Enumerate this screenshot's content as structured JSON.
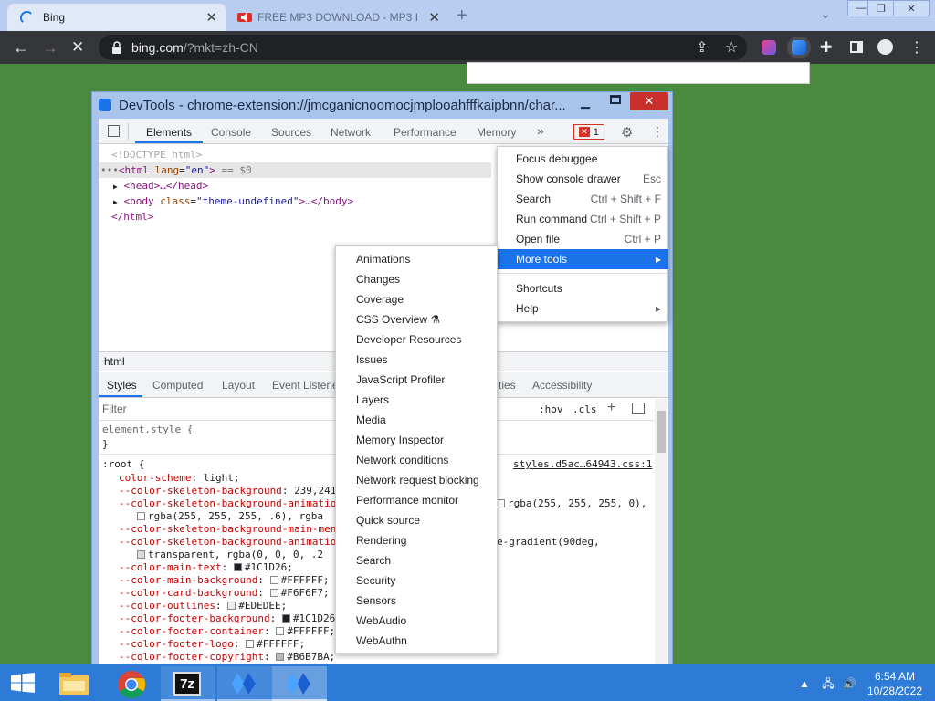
{
  "browser": {
    "tabs": [
      {
        "title": "Bing",
        "active": true
      },
      {
        "title": "FREE MP3 DOWNLOAD - MP3 I",
        "active": false
      }
    ],
    "new_tab_symbol": "+",
    "url_host": "bing.com",
    "url_rest": "/?mkt=zh-CN",
    "window_buttons": [
      "—",
      "❐",
      "✕"
    ]
  },
  "devtools": {
    "title": "DevTools - chrome-extension://jmcganicnoomocjmplooahfffkaipbnn/char...",
    "tabs": [
      "Elements",
      "Console",
      "Sources",
      "Network",
      "Performance",
      "Memory",
      "»"
    ],
    "error_count": "1",
    "dom": {
      "doctype": "<!DOCTYPE html>",
      "html_open": "<html",
      "html_attr": "lang",
      "html_val": "\"en\"",
      "html_close_bracket": ">",
      "selected_marker": "== $0",
      "head": "<head>…</head>",
      "body_open": "<body",
      "body_attr": "class",
      "body_val": "\"theme-undefined\"",
      "body_tail": ">…</body>",
      "html_end": "</html>"
    },
    "breadcrumb": "html",
    "styles_tabs": [
      "Styles",
      "Computed",
      "Layout",
      "Event Listene",
      "ties",
      "Accessibility"
    ],
    "filter_placeholder": "Filter",
    "hov": ":hov",
    "cls": ".cls",
    "styles": {
      "element_style": "element.style {",
      "close_brace": "}",
      "root_selector": ":root {",
      "source_link": "styles.d5ac…64943.css:1",
      "lines": [
        {
          "prop": "color-scheme",
          "val": "light;"
        },
        {
          "prop": "--color-skeleton-background",
          "val": "239,241"
        },
        {
          "prop": "--color-skeleton-background-animatio",
          "val": "rgba(255, 255, 255, 0),"
        },
        {
          "prop": "",
          "val": "rgba(255, 255, 255, .6),   rgba"
        },
        {
          "prop": "--color-skeleton-background-main-men",
          "val": ""
        },
        {
          "prop": "--color-skeleton-background-animatio",
          "val": "e-gradient(90deg,"
        },
        {
          "prop": "",
          "val": "transparent,   rgba(0, 0, 0, .2"
        },
        {
          "prop": "--color-main-text",
          "val": "#1C1D26;"
        },
        {
          "prop": "--color-main-background",
          "val": "#FFFFFF;"
        },
        {
          "prop": "--color-card-background",
          "val": "#F6F6F7;"
        },
        {
          "prop": "--color-outlines",
          "val": "#EDEDEE;"
        },
        {
          "prop": "--color-footer-background",
          "val": "#1C1D26"
        },
        {
          "prop": "--color-footer-container",
          "val": "#FFFFFF;"
        },
        {
          "prop": "--color-footer-logo",
          "val": "#FFFFFF;"
        },
        {
          "prop": "--color-footer-copyright",
          "val": "#B6B7BA;"
        }
      ]
    }
  },
  "main_menu": [
    {
      "label": "Focus debuggee",
      "shortcut": ""
    },
    {
      "label": "Show console drawer",
      "shortcut": "Esc"
    },
    {
      "label": "Search",
      "shortcut": "Ctrl + Shift + F"
    },
    {
      "label": "Run command",
      "shortcut": "Ctrl + Shift + P"
    },
    {
      "label": "Open file",
      "shortcut": "Ctrl + P"
    },
    {
      "label": "More tools",
      "shortcut": "▸"
    },
    {
      "label": "Shortcuts",
      "shortcut": ""
    },
    {
      "label": "Help",
      "shortcut": "▸"
    }
  ],
  "more_tools": [
    "Animations",
    "Changes",
    "Coverage",
    "CSS Overview ⚗",
    "Developer Resources",
    "Issues",
    "JavaScript Profiler",
    "Layers",
    "Media",
    "Memory Inspector",
    "Network conditions",
    "Network request blocking",
    "Performance monitor",
    "Quick source",
    "Rendering",
    "Search",
    "Security",
    "Sensors",
    "WebAudio",
    "WebAuthn"
  ],
  "taskbar": {
    "time": "6:54 AM",
    "date": "10/28/2022",
    "apps": [
      "file-explorer",
      "chrome",
      "7zip",
      "extension-a",
      "extension-b"
    ]
  },
  "colors": {
    "desktop": "#4a8a3f",
    "accent": "#1a73e8",
    "taskbar": "#2d7bd6"
  }
}
